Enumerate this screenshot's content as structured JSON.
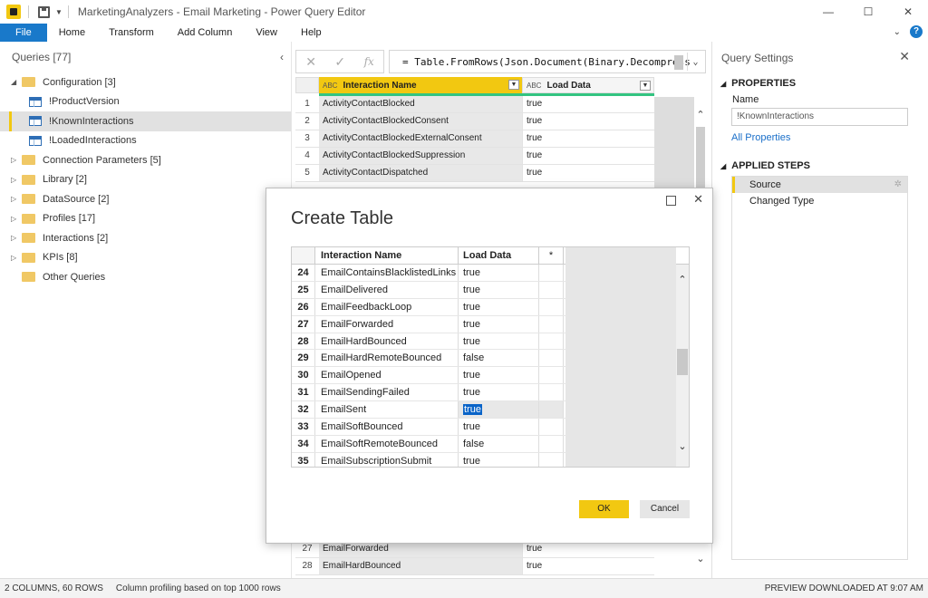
{
  "window": {
    "title": "MarketingAnalyzers - Email Marketing - Power Query Editor",
    "minimize": "—",
    "maximize": "☐",
    "close": "✕"
  },
  "ribbon": {
    "tabs": [
      "File",
      "Home",
      "Transform",
      "Add Column",
      "View",
      "Help"
    ]
  },
  "queries": {
    "header": "Queries [77]",
    "items": [
      {
        "label": "Configuration [3]",
        "type": "folder",
        "expanded": true
      },
      {
        "label": "!ProductVersion",
        "type": "table"
      },
      {
        "label": "!KnownInteractions",
        "type": "table",
        "selected": true
      },
      {
        "label": "!LoadedInteractions",
        "type": "table"
      },
      {
        "label": "Connection Parameters [5]",
        "type": "folder"
      },
      {
        "label": "Library [2]",
        "type": "folder"
      },
      {
        "label": "DataSource [2]",
        "type": "folder"
      },
      {
        "label": "Profiles [17]",
        "type": "folder"
      },
      {
        "label": "Interactions [2]",
        "type": "folder"
      },
      {
        "label": "KPIs [8]",
        "type": "folder"
      },
      {
        "label": "Other Queries",
        "type": "folder-noexpand"
      }
    ]
  },
  "formula": {
    "text": "= Table.FromRows(Json.Document(Binary.Decompress"
  },
  "grid": {
    "columns": [
      "Interaction Name",
      "Load Data"
    ],
    "rows": [
      {
        "n": "1",
        "name": "ActivityContactBlocked",
        "load": "true"
      },
      {
        "n": "2",
        "name": "ActivityContactBlockedConsent",
        "load": "true"
      },
      {
        "n": "3",
        "name": "ActivityContactBlockedExternalConsent",
        "load": "true"
      },
      {
        "n": "4",
        "name": "ActivityContactBlockedSuppression",
        "load": "true"
      },
      {
        "n": "5",
        "name": "ActivityContactDispatched",
        "load": "true"
      }
    ],
    "bottom_rows": [
      {
        "n": "27",
        "name": "EmailForwarded",
        "load": "true"
      },
      {
        "n": "28",
        "name": "EmailHardBounced",
        "load": "true"
      }
    ]
  },
  "settings": {
    "title": "Query Settings",
    "properties_title": "PROPERTIES",
    "name_label": "Name",
    "name_value": "!KnownInteractions",
    "all_properties": "All Properties",
    "applied_steps_title": "APPLIED STEPS",
    "steps": [
      "Source",
      "Changed Type"
    ]
  },
  "dialog": {
    "title": "Create Table",
    "columns": [
      "Interaction Name",
      "Load Data",
      "*"
    ],
    "rows": [
      {
        "n": "24",
        "name": "EmailContainsBlacklistedLinks",
        "load": "true"
      },
      {
        "n": "25",
        "name": "EmailDelivered",
        "load": "true"
      },
      {
        "n": "26",
        "name": "EmailFeedbackLoop",
        "load": "true"
      },
      {
        "n": "27",
        "name": "EmailForwarded",
        "load": "true"
      },
      {
        "n": "28",
        "name": "EmailHardBounced",
        "load": "true"
      },
      {
        "n": "29",
        "name": "EmailHardRemoteBounced",
        "load": "false"
      },
      {
        "n": "30",
        "name": "EmailOpened",
        "load": "true"
      },
      {
        "n": "31",
        "name": "EmailSendingFailed",
        "load": "true"
      },
      {
        "n": "32",
        "name": "EmailSent",
        "load": "true",
        "selected": true
      },
      {
        "n": "33",
        "name": "EmailSoftBounced",
        "load": "true"
      },
      {
        "n": "34",
        "name": "EmailSoftRemoteBounced",
        "load": "false"
      },
      {
        "n": "35",
        "name": "EmailSubscriptionSubmit",
        "load": "true"
      }
    ],
    "ok_label": "OK",
    "cancel_label": "Cancel"
  },
  "status": {
    "columns_rows": "2 COLUMNS, 60 ROWS",
    "profiling": "Column profiling based on top 1000 rows",
    "preview": "PREVIEW DOWNLOADED AT 9:07 AM"
  },
  "colors": {
    "accent_yellow": "#f2c811",
    "file_blue": "#1979ca",
    "link_blue": "#1a6fc9",
    "quality_green": "#33c481"
  }
}
